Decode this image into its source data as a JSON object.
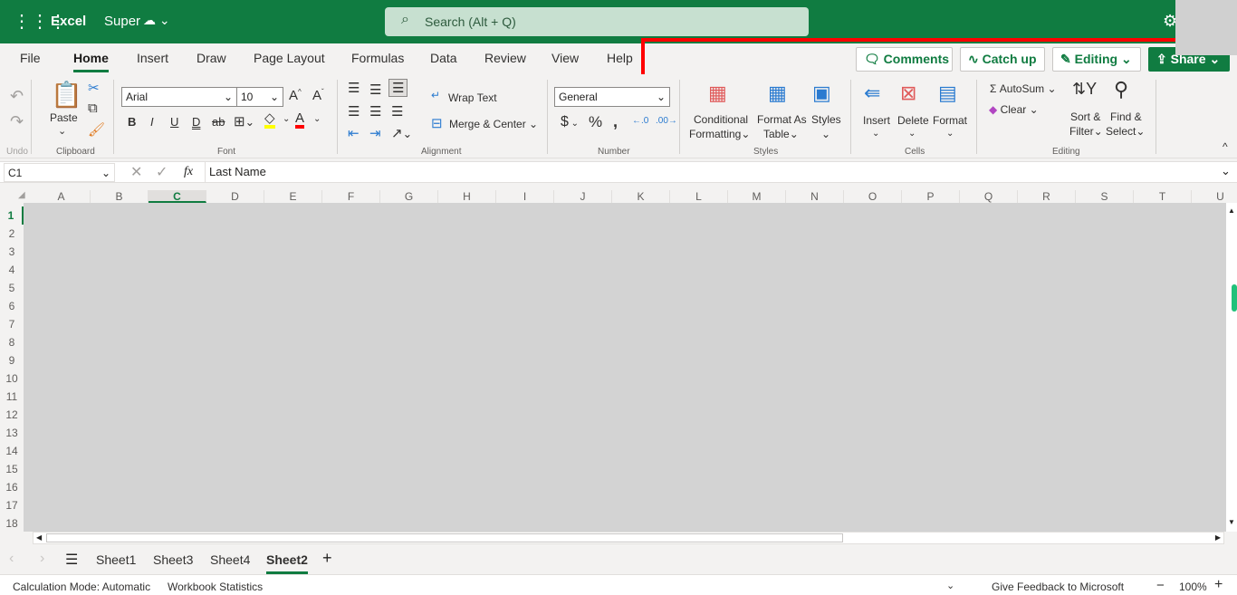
{
  "colors": {
    "brand": "#107c41",
    "highlight_box": "#ff0000",
    "fill_color": "#ffff00",
    "font_color": "#ff0000"
  },
  "topbar": {
    "waffle_icon": "app-launcher-icon",
    "app": "Excel",
    "file_name": "Super",
    "search_placeholder": "Search (Alt + Q)",
    "settings_icon": "gear-icon"
  },
  "tabs": [
    "File",
    "Home",
    "Insert",
    "Draw",
    "Page Layout",
    "Formulas",
    "Data",
    "Review",
    "View",
    "Help"
  ],
  "header_buttons": {
    "comments": "Comments",
    "catch_up": "Catch up",
    "editing": "Editing",
    "share": "Share"
  },
  "ribbon": {
    "undo_group": "Undo",
    "clipboard": {
      "paste": "Paste",
      "group": "Clipboard"
    },
    "font": {
      "name": "Arial",
      "size": "10",
      "bold": "B",
      "italic": "I",
      "underline": "U",
      "double_underline": "D",
      "strike": "ab",
      "font_color": "A",
      "grow": "A",
      "shrink": "A",
      "group": "Font"
    },
    "alignment": {
      "wrap": "Wrap Text",
      "merge": "Merge & Center",
      "group": "Alignment"
    },
    "number": {
      "format": "General",
      "currency": "$",
      "percent": "%",
      "comma": "ŉ",
      "group": "Number"
    },
    "styles": {
      "conditional1": "Conditional",
      "conditional2": "Formatting",
      "format_as1": "Format As",
      "format_as2": "Table",
      "styles": "Styles",
      "group": "Styles"
    },
    "cells": {
      "insert": "Insert",
      "delete": "Delete",
      "format": "Format",
      "group": "Cells"
    },
    "editing": {
      "autosum": "AutoSum",
      "clear": "Clear",
      "sort1": "Sort &",
      "sort2": "Filter",
      "find1": "Find &",
      "find2": "Select",
      "group": "Editing"
    }
  },
  "formula_bar": {
    "name_box": "C1",
    "fx": "fx",
    "value": "Last Name"
  },
  "columns": [
    "A",
    "B",
    "C",
    "D",
    "E",
    "F",
    "G",
    "H",
    "I",
    "J",
    "K",
    "L",
    "M",
    "N",
    "O",
    "P",
    "Q",
    "R",
    "S",
    "T",
    "U"
  ],
  "active_column": "C",
  "rows": [
    "1",
    "2",
    "3",
    "4",
    "5",
    "6",
    "7",
    "8",
    "9",
    "10",
    "11",
    "12",
    "13",
    "14",
    "15",
    "16",
    "17",
    "18"
  ],
  "sheets": [
    "Sheet1",
    "Sheet3",
    "Sheet4",
    "Sheet2"
  ],
  "active_sheet": "Sheet2",
  "status": {
    "calc_mode": "Calculation Mode: Automatic",
    "stats": "Workbook Statistics",
    "feedback": "Give Feedback to Microsoft",
    "zoom": "100%",
    "zoom_out": "−",
    "zoom_in": "+"
  }
}
